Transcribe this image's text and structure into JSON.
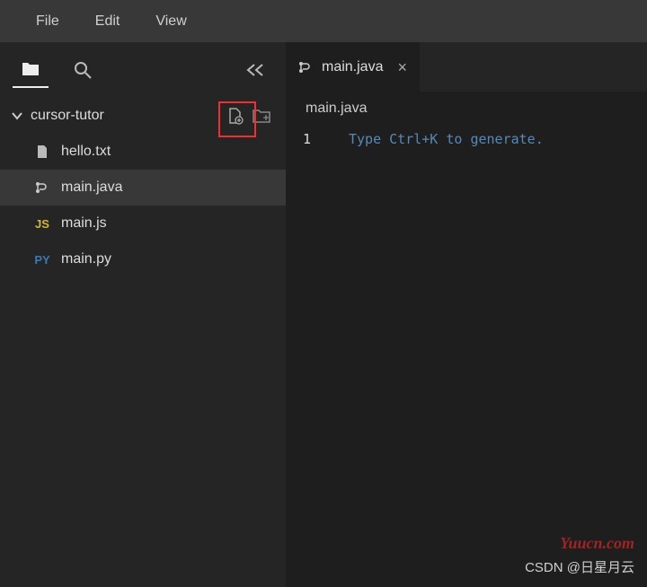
{
  "menu": {
    "file": "File",
    "edit": "Edit",
    "view": "View"
  },
  "sidebar": {
    "folder_name": "cursor-tutor",
    "files": [
      {
        "name": "hello.txt",
        "icon": "file"
      },
      {
        "name": "main.java",
        "icon": "java"
      },
      {
        "name": "main.js",
        "icon": "js"
      },
      {
        "name": "main.py",
        "icon": "py"
      }
    ]
  },
  "tabs": [
    {
      "label": "main.java"
    }
  ],
  "breadcrumb": "main.java",
  "editor": {
    "line_number": "1",
    "placeholder": "Type Ctrl+K to generate."
  },
  "watermark": {
    "site": "Yuucn.com",
    "credit": "CSDN @日星月云"
  }
}
